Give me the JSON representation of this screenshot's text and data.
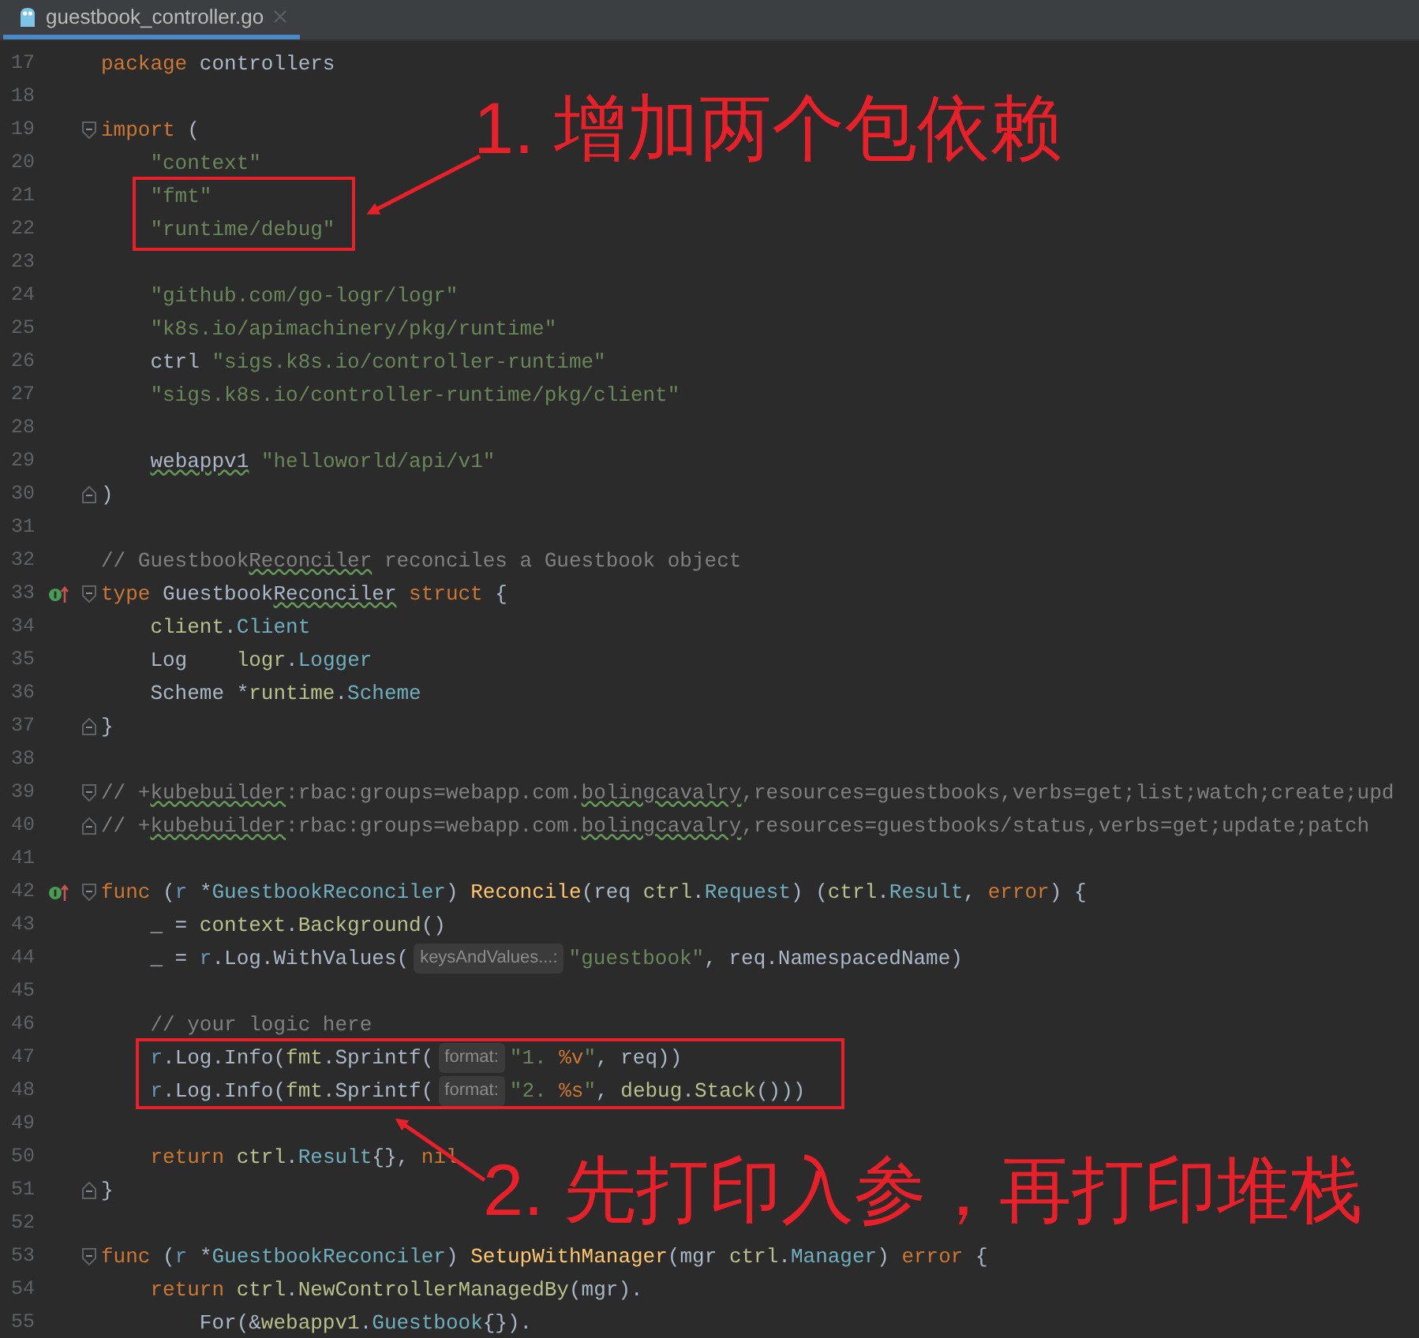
{
  "tabs": [
    {
      "label": "guestbook_controller.go",
      "selected": true
    }
  ],
  "lines": [
    {
      "number": "17",
      "implements": false,
      "fold_start": false,
      "fold_end": false,
      "tokens": [
        {
          "kind": "kw",
          "text": "package"
        },
        {
          "kind": "plain",
          "text": " controllers"
        }
      ]
    },
    {
      "number": "18",
      "implements": false,
      "fold_start": false,
      "fold_end": false
    },
    {
      "number": "19",
      "implements": false,
      "fold_start": true,
      "fold_end": false,
      "tokens": [
        {
          "kind": "kw",
          "text": "import"
        },
        {
          "kind": "plain",
          "text": " ("
        }
      ]
    },
    {
      "number": "20",
      "implements": false,
      "fold_start": false,
      "fold_end": false,
      "tokens": [
        {
          "kind": "str",
          "text": "    \"context\""
        }
      ]
    },
    {
      "number": "21",
      "implements": false,
      "fold_start": false,
      "fold_end": false,
      "tokens": [
        {
          "kind": "str",
          "text": "    \"fmt\""
        }
      ]
    },
    {
      "number": "22",
      "implements": false,
      "fold_start": false,
      "fold_end": false,
      "tokens": [
        {
          "kind": "str",
          "text": "    \"runtime/debug\""
        }
      ]
    },
    {
      "number": "23",
      "implements": false,
      "fold_start": false,
      "fold_end": false
    },
    {
      "number": "24",
      "implements": false,
      "fold_start": false,
      "fold_end": false,
      "tokens": [
        {
          "kind": "str",
          "text": "    \"github.com/go-logr/logr\""
        }
      ]
    },
    {
      "number": "25",
      "implements": false,
      "fold_start": false,
      "fold_end": false,
      "tokens": [
        {
          "kind": "str",
          "text": "    \"k8s.io/apimachinery/pkg/runtime\""
        }
      ]
    },
    {
      "number": "26",
      "implements": false,
      "fold_start": false,
      "fold_end": false,
      "tokens": [
        {
          "kind": "plain",
          "text": "    ctrl "
        },
        {
          "kind": "str",
          "text": "\"sigs.k8s.io/controller-runtime\""
        }
      ]
    },
    {
      "number": "27",
      "implements": false,
      "fold_start": false,
      "fold_end": false,
      "tokens": [
        {
          "kind": "str",
          "text": "    \"sigs.k8s.io/controller-runtime/pkg/client\""
        }
      ]
    },
    {
      "number": "28",
      "implements": false,
      "fold_start": false,
      "fold_end": false
    },
    {
      "number": "29",
      "implements": false,
      "fold_start": false,
      "fold_end": false,
      "tokens": [
        {
          "kind": "typo",
          "text": "    webappv1"
        },
        {
          "kind": "str",
          "text": " \"helloworld/api/v1\""
        }
      ]
    },
    {
      "number": "30",
      "implements": false,
      "fold_start": false,
      "fold_end": true,
      "tokens": [
        {
          "kind": "plain",
          "text": ")"
        }
      ]
    },
    {
      "number": "31",
      "implements": false,
      "fold_start": false,
      "fold_end": false
    },
    {
      "number": "32",
      "implements": false,
      "fold_start": false,
      "fold_end": false,
      "tokens": [
        {
          "kind": "comment",
          "text": "// Guestbook"
        },
        {
          "kind": "commenttypo",
          "text": "Reconciler"
        },
        {
          "kind": "comment",
          "text": " reconciles a Guestbook object"
        }
      ]
    },
    {
      "number": "33",
      "implements": true,
      "fold_start": true,
      "fold_end": false,
      "tokens": [
        {
          "kind": "kw",
          "text": "type"
        },
        {
          "kind": "plain",
          "text": " Guestbook"
        },
        {
          "kind": "typo",
          "text": "Reconciler"
        },
        {
          "kind": "kw",
          "text": " struct"
        },
        {
          "kind": "plain",
          "text": " {"
        }
      ]
    },
    {
      "number": "34",
      "implements": false,
      "fold_start": false,
      "fold_end": false,
      "tokens": [
        {
          "kind": "pkg",
          "text": "    client"
        },
        {
          "kind": "plain",
          "text": "."
        },
        {
          "kind": "type",
          "text": "Client"
        }
      ]
    },
    {
      "number": "35",
      "implements": false,
      "fold_start": false,
      "fold_end": false,
      "tokens": [
        {
          "kind": "plain",
          "text": "    Log    "
        },
        {
          "kind": "pkg",
          "text": "logr"
        },
        {
          "kind": "plain",
          "text": "."
        },
        {
          "kind": "type",
          "text": "Logger"
        }
      ]
    },
    {
      "number": "36",
      "implements": false,
      "fold_start": false,
      "fold_end": false,
      "tokens": [
        {
          "kind": "plain",
          "text": "    Scheme *"
        },
        {
          "kind": "pkg",
          "text": "runtime"
        },
        {
          "kind": "plain",
          "text": "."
        },
        {
          "kind": "type",
          "text": "Scheme"
        }
      ]
    },
    {
      "number": "37",
      "implements": false,
      "fold_start": false,
      "fold_end": true,
      "tokens": [
        {
          "kind": "plain",
          "text": "}"
        }
      ]
    },
    {
      "number": "38",
      "implements": false,
      "fold_start": false,
      "fold_end": false
    },
    {
      "number": "39",
      "implements": false,
      "fold_start": true,
      "fold_end": false,
      "tokens": [
        {
          "kind": "comment",
          "text": "// +"
        },
        {
          "kind": "commenttypo",
          "text": "kubebuilder"
        },
        {
          "kind": "comment",
          "text": ":rbac:groups=webapp.com."
        },
        {
          "kind": "commenttypo",
          "text": "bolingcavalry"
        },
        {
          "kind": "comment",
          "text": ",resources=guestbooks,verbs=get;list;watch;create;upd"
        }
      ]
    },
    {
      "number": "40",
      "implements": false,
      "fold_start": false,
      "fold_end": true,
      "tokens": [
        {
          "kind": "comment",
          "text": "// +"
        },
        {
          "kind": "commenttypo",
          "text": "kubebuilder"
        },
        {
          "kind": "comment",
          "text": ":rbac:groups=webapp.com."
        },
        {
          "kind": "commenttypo",
          "text": "bolingcavalry"
        },
        {
          "kind": "comment",
          "text": ",resources=guestbooks/status,verbs=get;update;patch"
        }
      ]
    },
    {
      "number": "41",
      "implements": false,
      "fold_start": false,
      "fold_end": false
    },
    {
      "number": "42",
      "implements": true,
      "fold_start": true,
      "fold_end": false,
      "tokens": [
        {
          "kind": "kw",
          "text": "func"
        },
        {
          "kind": "plain",
          "text": " ("
        },
        {
          "kind": "recv",
          "text": "r"
        },
        {
          "kind": "plain",
          "text": " *"
        },
        {
          "kind": "type",
          "text": "GuestbookReconciler"
        },
        {
          "kind": "plain",
          "text": ") "
        },
        {
          "kind": "func",
          "text": "Reconcile"
        },
        {
          "kind": "plain",
          "text": "(req "
        },
        {
          "kind": "pkg",
          "text": "ctrl"
        },
        {
          "kind": "plain",
          "text": "."
        },
        {
          "kind": "type",
          "text": "Request"
        },
        {
          "kind": "plain",
          "text": ") ("
        },
        {
          "kind": "pkg",
          "text": "ctrl"
        },
        {
          "kind": "plain",
          "text": "."
        },
        {
          "kind": "type",
          "text": "Result"
        },
        {
          "kind": "plain",
          "text": ", "
        },
        {
          "kind": "kw",
          "text": "error"
        },
        {
          "kind": "plain",
          "text": ") {"
        }
      ]
    },
    {
      "number": "43",
      "implements": false,
      "fold_start": false,
      "fold_end": false,
      "tokens": [
        {
          "kind": "plain",
          "text": "    _ = "
        },
        {
          "kind": "pkg",
          "text": "context"
        },
        {
          "kind": "plain",
          "text": "."
        },
        {
          "kind": "pkg",
          "text": "Background"
        },
        {
          "kind": "plain",
          "text": "()"
        }
      ]
    },
    {
      "number": "44",
      "implements": false,
      "fold_start": false,
      "fold_end": false,
      "tokens": [
        {
          "kind": "plain",
          "text": "    _ = "
        },
        {
          "kind": "recv",
          "text": "r"
        },
        {
          "kind": "plain",
          "text": ".Log.WithValues("
        },
        {
          "kind": "hint",
          "text": "keysAndValues...:"
        },
        {
          "kind": "str",
          "text": "\"guestbook\""
        },
        {
          "kind": "plain",
          "text": ", req.NamespacedName)"
        }
      ]
    },
    {
      "number": "45",
      "implements": false,
      "fold_start": false,
      "fold_end": false
    },
    {
      "number": "46",
      "implements": false,
      "fold_start": false,
      "fold_end": false,
      "tokens": [
        {
          "kind": "comment",
          "text": "    // your logic here"
        }
      ]
    },
    {
      "number": "47",
      "implements": false,
      "fold_start": false,
      "fold_end": false,
      "tokens": [
        {
          "kind": "recv",
          "text": "    r"
        },
        {
          "kind": "plain",
          "text": ".Log.Info("
        },
        {
          "kind": "pkg",
          "text": "fmt"
        },
        {
          "kind": "plain",
          "text": ".Sprintf("
        },
        {
          "kind": "hint",
          "text": "format:"
        },
        {
          "kind": "str",
          "text": "\"1. "
        },
        {
          "kind": "verb",
          "text": "%v"
        },
        {
          "kind": "str",
          "text": "\""
        },
        {
          "kind": "plain",
          "text": ", req))"
        }
      ]
    },
    {
      "number": "48",
      "implements": false,
      "fold_start": false,
      "fold_end": false,
      "tokens": [
        {
          "kind": "recv",
          "text": "    r"
        },
        {
          "kind": "plain",
          "text": ".Log.Info("
        },
        {
          "kind": "pkg",
          "text": "fmt"
        },
        {
          "kind": "plain",
          "text": ".Sprintf("
        },
        {
          "kind": "hint",
          "text": "format:"
        },
        {
          "kind": "str",
          "text": "\"2. "
        },
        {
          "kind": "verb",
          "text": "%s"
        },
        {
          "kind": "str",
          "text": "\""
        },
        {
          "kind": "plain",
          "text": ", "
        },
        {
          "kind": "pkg",
          "text": "debug"
        },
        {
          "kind": "plain",
          "text": "."
        },
        {
          "kind": "pkg",
          "text": "Stack"
        },
        {
          "kind": "plain",
          "text": "()))"
        }
      ]
    },
    {
      "number": "49",
      "implements": false,
      "fold_start": false,
      "fold_end": false
    },
    {
      "number": "50",
      "implements": false,
      "fold_start": false,
      "fold_end": false,
      "tokens": [
        {
          "kind": "kw",
          "text": "    return "
        },
        {
          "kind": "pkg",
          "text": "ctrl"
        },
        {
          "kind": "plain",
          "text": "."
        },
        {
          "kind": "type",
          "text": "Result"
        },
        {
          "kind": "plain",
          "text": "{}, "
        },
        {
          "kind": "kw",
          "text": "nil"
        }
      ]
    },
    {
      "number": "51",
      "implements": false,
      "fold_start": false,
      "fold_end": true,
      "tokens": [
        {
          "kind": "plain",
          "text": "}"
        }
      ]
    },
    {
      "number": "52",
      "implements": false,
      "fold_start": false,
      "fold_end": false
    },
    {
      "number": "53",
      "implements": false,
      "fold_start": true,
      "fold_end": false,
      "tokens": [
        {
          "kind": "kw",
          "text": "func"
        },
        {
          "kind": "plain",
          "text": " ("
        },
        {
          "kind": "recv",
          "text": "r"
        },
        {
          "kind": "plain",
          "text": " *"
        },
        {
          "kind": "type",
          "text": "GuestbookReconciler"
        },
        {
          "kind": "plain",
          "text": ") "
        },
        {
          "kind": "func",
          "text": "SetupWithManager"
        },
        {
          "kind": "plain",
          "text": "(mgr "
        },
        {
          "kind": "pkg",
          "text": "ctrl"
        },
        {
          "kind": "plain",
          "text": "."
        },
        {
          "kind": "type",
          "text": "Manager"
        },
        {
          "kind": "plain",
          "text": ") "
        },
        {
          "kind": "kw",
          "text": "error"
        },
        {
          "kind": "plain",
          "text": " {"
        }
      ]
    },
    {
      "number": "54",
      "implements": false,
      "fold_start": false,
      "fold_end": false,
      "tokens": [
        {
          "kind": "kw",
          "text": "    return "
        },
        {
          "kind": "pkg",
          "text": "ctrl"
        },
        {
          "kind": "plain",
          "text": "."
        },
        {
          "kind": "pkg",
          "text": "NewControllerManagedBy"
        },
        {
          "kind": "plain",
          "text": "(mgr)."
        }
      ]
    },
    {
      "number": "55",
      "implements": false,
      "fold_start": false,
      "fold_end": false,
      "tokens": [
        {
          "kind": "plain",
          "text": "        For(&"
        },
        {
          "kind": "pkg",
          "text": "webappv1"
        },
        {
          "kind": "plain",
          "text": "."
        },
        {
          "kind": "type",
          "text": "Guestbook"
        },
        {
          "kind": "plain",
          "text": "{})."
        }
      ]
    }
  ],
  "annotations": [
    {
      "text": "1. 增加两个包依赖"
    },
    {
      "text": "2. 先打印入参，再打印堆栈"
    }
  ]
}
